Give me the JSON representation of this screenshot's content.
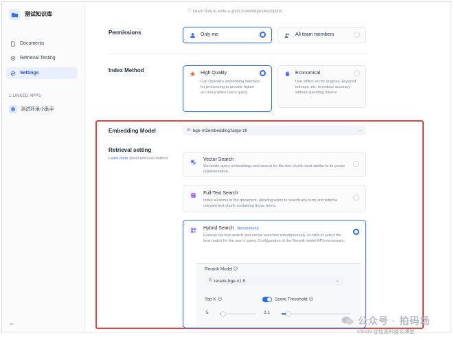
{
  "sidebar": {
    "dataset_name": "测试知识库",
    "dataset_sub": "—",
    "nav": [
      {
        "label": "Documents",
        "icon": "document-icon"
      },
      {
        "label": "Retrieval Testing",
        "icon": "target-icon"
      },
      {
        "label": "Settings",
        "icon": "gear-icon",
        "active": true
      }
    ],
    "linked_title": "1 LINKED APPS",
    "linked_app": "测试环境小助手"
  },
  "main": {
    "learn_link": "ⓘ Learn how to write a good knowledge description.",
    "permissions": {
      "label": "Permissions",
      "options": [
        {
          "title": "Only me",
          "selected": true
        },
        {
          "title": "All team members",
          "selected": false
        }
      ]
    },
    "index_method": {
      "label": "Index Method",
      "options": [
        {
          "title": "High Quality",
          "desc": "Call OpenAI's embedding interface for processing to provide higher accuracy when users query.",
          "selected": true
        },
        {
          "title": "Economical",
          "desc": "Use offline vector engines, keyword indexes, etc. to reduce accuracy without spending tokens",
          "selected": false
        }
      ]
    },
    "embedding_model": {
      "label": "Embedding Model",
      "prefix": "AI",
      "value": "bge-m3embedding:large-zh"
    },
    "retrieval": {
      "label": "Retrieval setting",
      "learn_more": "Learn more",
      "learn_more_rest": " about retrieval method.",
      "options": [
        {
          "title": "Vector Search",
          "desc": "Generate query embeddings and search for the text chunk most similar to its vector representation.",
          "selected": false
        },
        {
          "title": "Full-Text Search",
          "desc": "Index all terms in the document, allowing users to search any term and retrieve relevant text chunk containing those terms.",
          "selected": false
        },
        {
          "title": "Hybrid Search",
          "badge": "Recommend",
          "desc": "Execute full-text search and vector searches simultaneously, re-rank to select the best match for the user's query. Configuration of the Rerank model APIs necessary.",
          "selected": true
        }
      ],
      "rerank_label": "Rerank Model",
      "rerank_prefix": "R",
      "rerank_value": "rerank-bge-v1.5",
      "topk_label": "Top K",
      "topk_value": "5",
      "topk_fraction": 0.1,
      "score_label": "Score Threshold",
      "score_enabled": true,
      "score_value": "0.1",
      "score_fraction": 0.1
    }
  },
  "watermark": {
    "line1": "公众号 · 拍码场",
    "line2": "CSDN @信息科技云课堂"
  },
  "colors": {
    "accent": "#2f6bf2",
    "highlight": "#e5443c"
  }
}
